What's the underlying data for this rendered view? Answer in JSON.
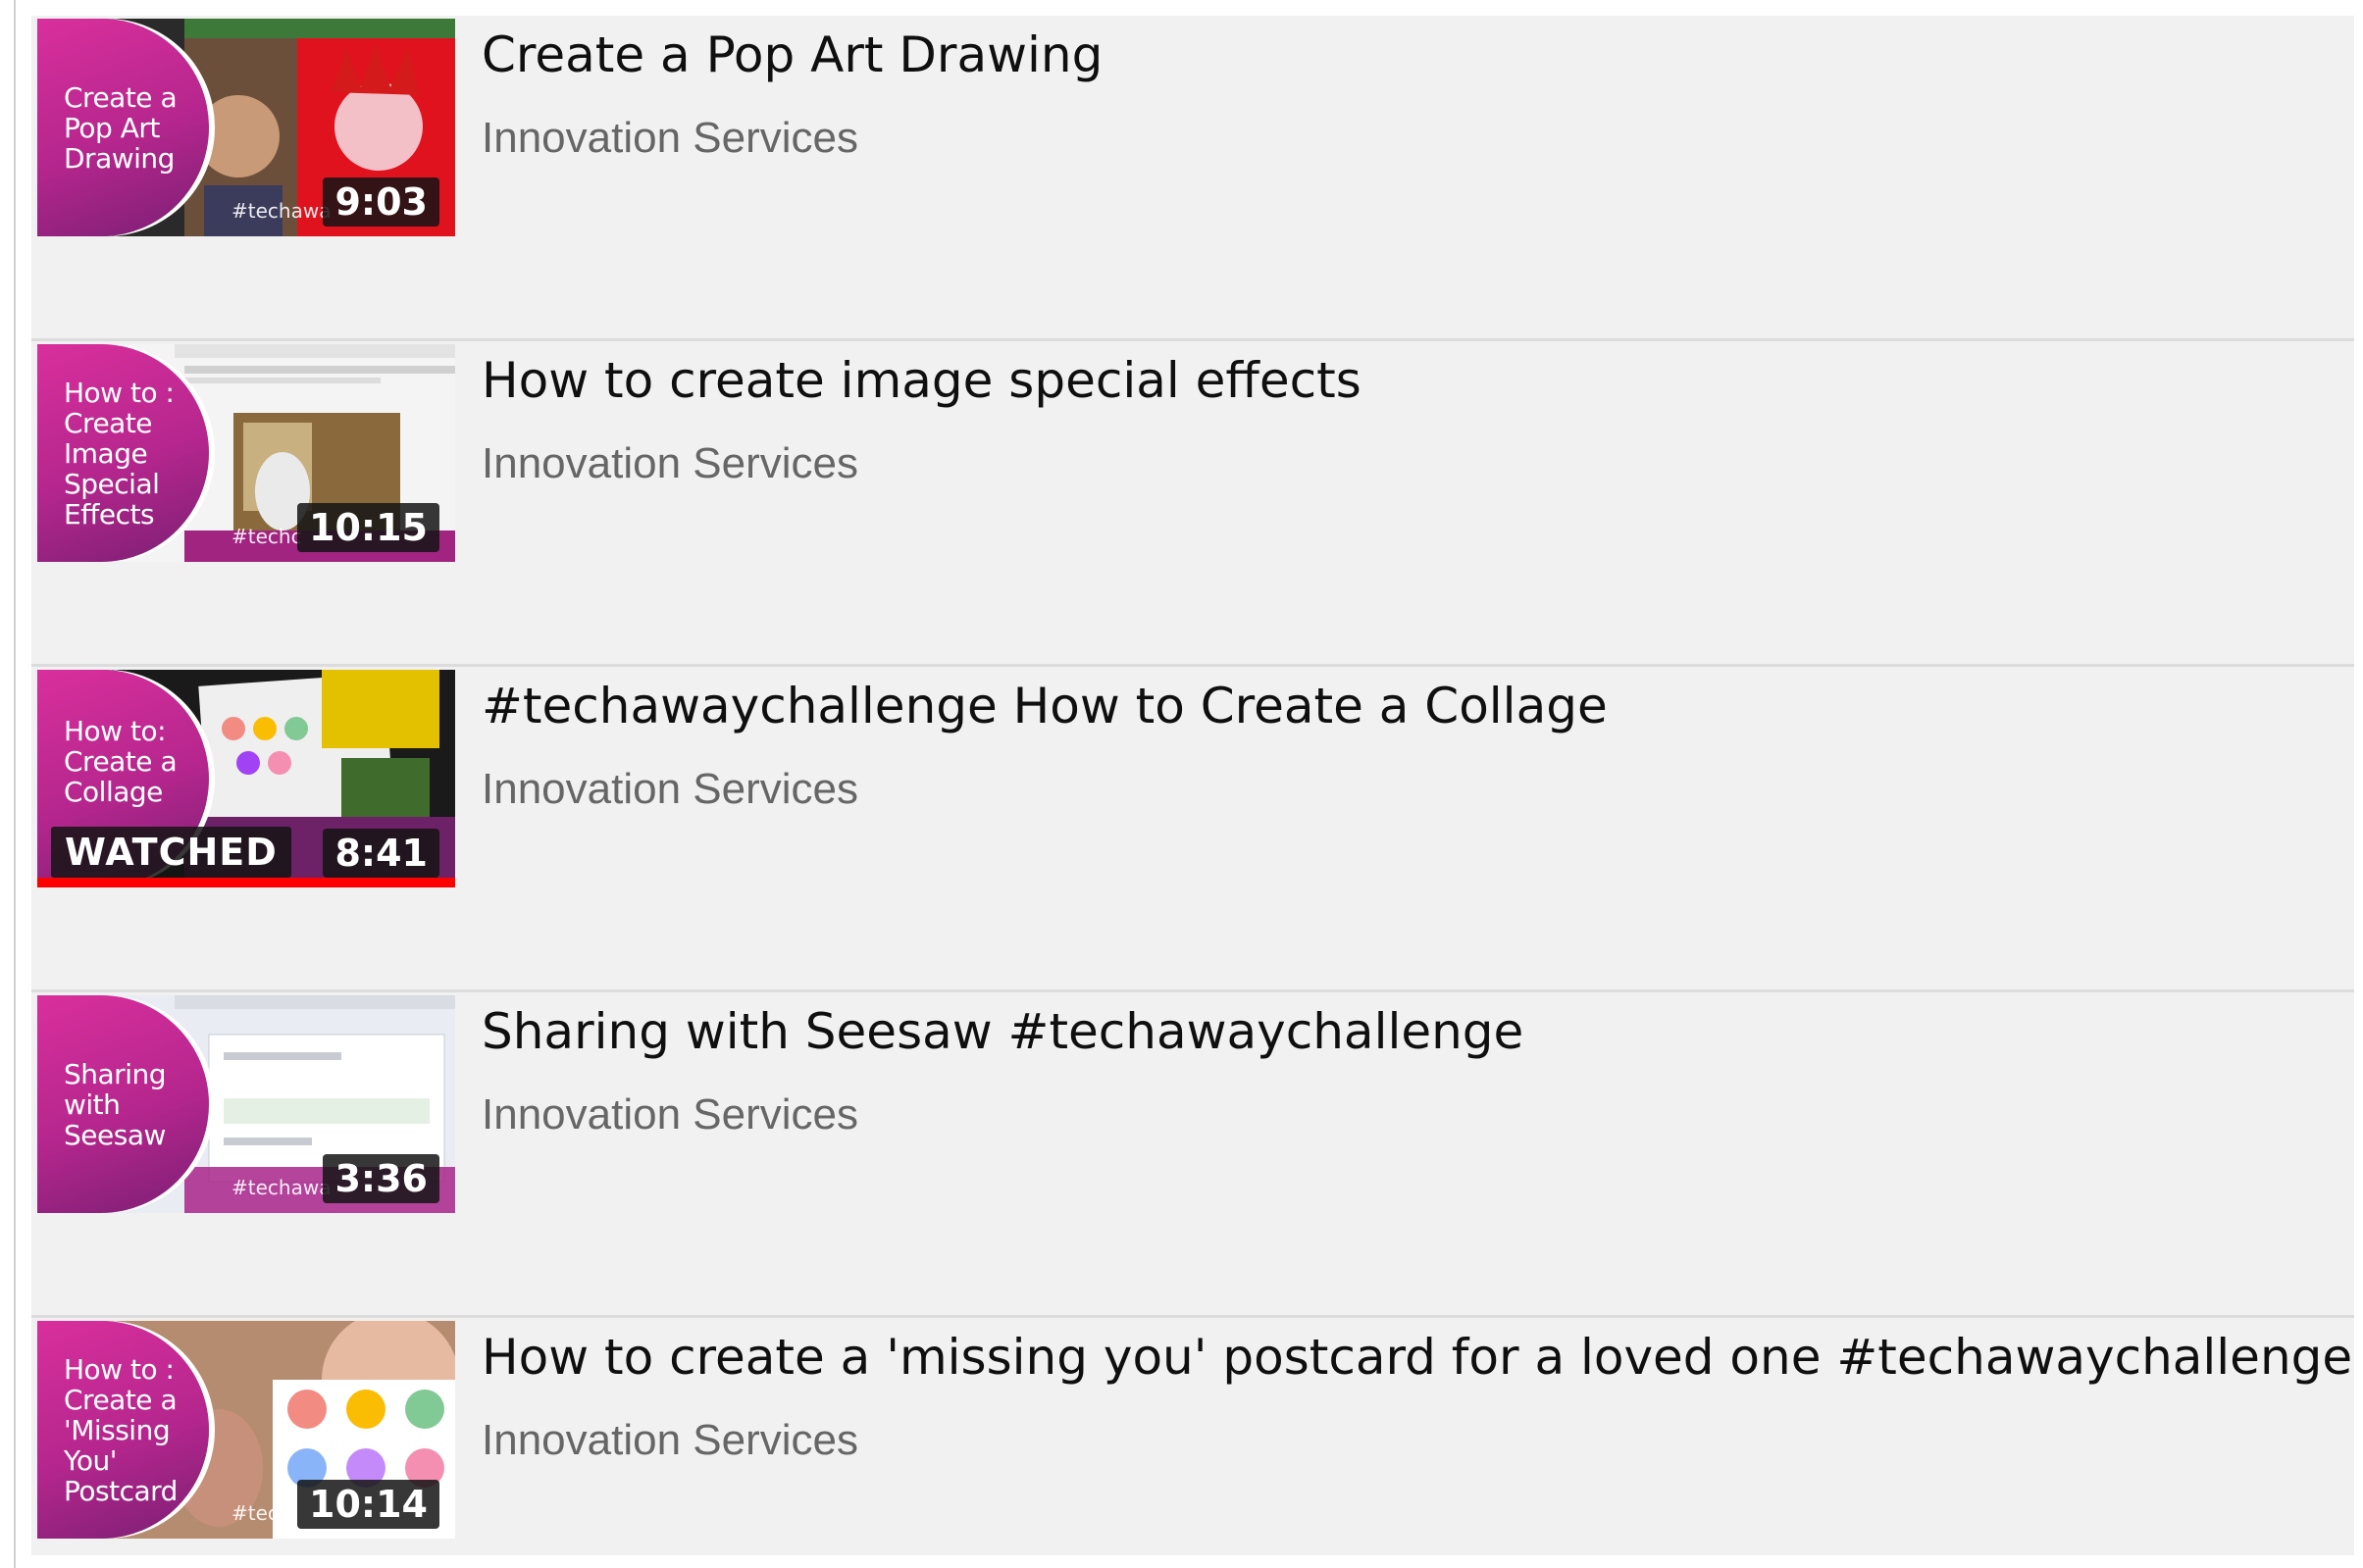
{
  "videos": [
    {
      "title": "Create a Pop Art Drawing",
      "channel": "Innovation Services",
      "duration": "9:03",
      "thumbnail_lines": [
        "Create a",
        "Pop Art",
        "Drawing"
      ],
      "hashtag": "#techawa",
      "watched": false
    },
    {
      "title": "How to create image special effects",
      "channel": "Innovation Services",
      "duration": "10:15",
      "thumbnail_lines": [
        "How to :",
        "Create",
        "Image",
        "Special",
        "Effects"
      ],
      "hashtag": "#techc",
      "watched": false
    },
    {
      "title": "#techawaychallenge How to Create a Collage",
      "channel": "Innovation Services",
      "duration": "8:41",
      "thumbnail_lines": [
        "How to:",
        "Create a",
        "Collage"
      ],
      "hashtag": "",
      "watched": true,
      "watched_label": "WATCHED",
      "watched_progress": 1.0
    },
    {
      "title": "Sharing with Seesaw #techawaychallenge",
      "channel": "Innovation Services",
      "duration": "3:36",
      "thumbnail_lines": [
        "Sharing",
        "with",
        "Seesaw"
      ],
      "hashtag": "#techawa",
      "watched": false
    },
    {
      "title": "How to create a 'missing you' postcard for a loved one #techawaychallenge",
      "channel": "Innovation Services",
      "duration": "10:14",
      "thumbnail_lines": [
        "How to :",
        "Create a",
        "'Missing",
        "You'",
        "Postcard"
      ],
      "hashtag": "#techc",
      "watched": false
    }
  ],
  "colors": {
    "background": "#f1f1f1",
    "thumbnail_brand": "#c02a93",
    "watched_bar": "#ff0000",
    "title_text": "#0f0f0f",
    "channel_text": "#666666"
  }
}
